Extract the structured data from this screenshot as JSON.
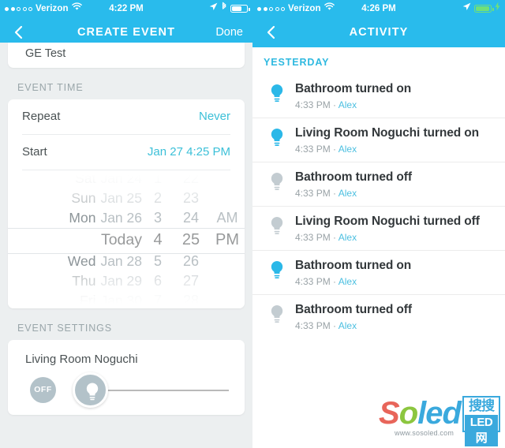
{
  "left": {
    "status": {
      "carrier": "Verizon",
      "time": "4:22 PM",
      "signal_filled": 2,
      "signal_total": 5,
      "wifi_icon": "wifi-icon",
      "location_icon": "location-arrow-icon",
      "bluetooth_icon": "bluetooth-icon",
      "battery_icon": "battery-icon",
      "battery_level": 62,
      "battery_charging": false
    },
    "nav": {
      "back_icon": "chevron-left-icon",
      "title": "CREATE EVENT",
      "done_label": "Done"
    },
    "event_name": "GE Test",
    "event_time_label": "EVENT TIME",
    "rows": [
      {
        "label": "Repeat",
        "value": "Never"
      },
      {
        "label": "Start",
        "value": "Jan 27 4:25 PM"
      }
    ],
    "picker": {
      "dates": [
        {
          "weekday": "Sat",
          "date": "Jan 24"
        },
        {
          "weekday": "Sun",
          "date": "Jan 25"
        },
        {
          "weekday": "Mon",
          "date": "Jan 26"
        },
        {
          "weekday": "",
          "date": "Today"
        },
        {
          "weekday": "Wed",
          "date": "Jan 28"
        },
        {
          "weekday": "Thu",
          "date": "Jan 29"
        },
        {
          "weekday": "Fri",
          "date": "Jan 30"
        }
      ],
      "hours": [
        "1",
        "2",
        "3",
        "4",
        "5",
        "6",
        "7"
      ],
      "minutes": [
        "22",
        "23",
        "24",
        "25",
        "26",
        "27",
        "28"
      ],
      "ampm": [
        "",
        "",
        "AM",
        "PM",
        "",
        "",
        ""
      ],
      "selected_index": 3,
      "selected_date": "Today",
      "selected_hour": "4",
      "selected_minute": "25",
      "selected_ampm": "PM"
    },
    "event_settings_label": "EVENT SETTINGS",
    "device_name": "Living Room Noguchi",
    "power_state": "OFF",
    "brightness_icon": "lightbulb-icon",
    "brightness_percent": 0
  },
  "right": {
    "status": {
      "carrier": "Verizon",
      "time": "4:26 PM",
      "signal_filled": 2,
      "signal_total": 5,
      "wifi_icon": "wifi-icon",
      "location_icon": "location-arrow-icon",
      "battery_icon": "battery-icon",
      "battery_level": 85,
      "battery_charging": true,
      "charging_icon": "lightning-bolt-icon"
    },
    "nav": {
      "back_icon": "chevron-left-icon",
      "title": "ACTIVITY"
    },
    "day_header": "YESTERDAY",
    "activities": [
      {
        "title": "Bathroom turned on",
        "time": "4:33 PM",
        "user": "Alex",
        "state": "on",
        "icon": "lightbulb-icon"
      },
      {
        "title": "Living Room Noguchi turned on",
        "time": "4:33 PM",
        "user": "Alex",
        "state": "on",
        "icon": "lightbulb-icon"
      },
      {
        "title": "Bathroom turned off",
        "time": "4:33 PM",
        "user": "Alex",
        "state": "off",
        "icon": "lightbulb-icon"
      },
      {
        "title": "Living Room Noguchi turned off",
        "time": "4:33 PM",
        "user": "Alex",
        "state": "off",
        "icon": "lightbulb-icon"
      },
      {
        "title": "Bathroom turned on",
        "time": "4:33 PM",
        "user": "Alex",
        "state": "on",
        "icon": "lightbulb-icon"
      },
      {
        "title": "Bathroom turned off",
        "time": "4:33 PM",
        "user": "Alex",
        "state": "off",
        "icon": "lightbulb-icon"
      }
    ],
    "meta_separator": " · "
  },
  "watermark": {
    "s": "S",
    "o": "o",
    "led": "led",
    "url": "www.sosoled.com",
    "cn_top": "搜搜",
    "cn_bottom": "LED网"
  },
  "colors": {
    "brand": "#29bbec",
    "accent": "#3cc0d8",
    "bulb_on": "#2bb8e8",
    "bulb_off": "#c3ccd1",
    "battery_charging": "#6fe07a"
  }
}
